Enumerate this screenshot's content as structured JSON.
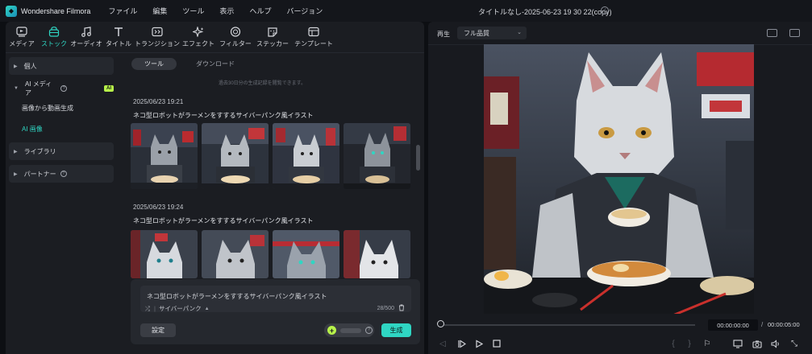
{
  "app": {
    "name": "Wondershare Filmora",
    "logo": "filmora-logo"
  },
  "menu": [
    "ファイル",
    "編集",
    "ツール",
    "表示",
    "ヘルプ",
    "バージョン"
  ],
  "document": {
    "title": "タイトルなし-2025-06-23 19 30 22(copy)"
  },
  "toolbar": [
    {
      "id": "media",
      "label": "メディア",
      "icon": "media-icon"
    },
    {
      "id": "stock",
      "label": "ストック",
      "icon": "stock-icon",
      "active": true
    },
    {
      "id": "audio",
      "label": "オーディオ",
      "icon": "music-note-icon"
    },
    {
      "id": "title",
      "label": "タイトル",
      "icon": "text-icon"
    },
    {
      "id": "transition",
      "label": "トランジション",
      "icon": "transition-icon"
    },
    {
      "id": "effect",
      "label": "エフェクト",
      "icon": "sparkle-icon"
    },
    {
      "id": "filter",
      "label": "フィルター",
      "icon": "filter-icon"
    },
    {
      "id": "sticker",
      "label": "ステッカー",
      "icon": "sticker-icon"
    },
    {
      "id": "template",
      "label": "テンプレート",
      "icon": "template-icon"
    }
  ],
  "sidebar": {
    "personal": "個人",
    "ai_media": {
      "label": "AI メディア",
      "badge": "AI"
    },
    "ai_items": [
      "画像から動画生成",
      "AI 画像"
    ],
    "library": "ライブラリ",
    "partner": "パートナー"
  },
  "tabs": [
    "ツール",
    "ダウンロード"
  ],
  "hint": "過去30日分の生成記録を閲覧できます。",
  "groups": [
    {
      "timestamp": "2025/06/23 19:21",
      "prompt": "ネコ型ロボットがラーメンをすするサイバーパンク風イラスト"
    },
    {
      "timestamp": "2025/06/23 19:24",
      "prompt": "ネコ型ロボットがラーメンをすするサイバーパンク風イラスト"
    }
  ],
  "prompt_box": {
    "text": "ネコ型ロボットがラーメンをすするサイバーパンク風イラスト",
    "style": "サイバーパンク",
    "count": "28/500",
    "settings": "設定",
    "generate": "生成"
  },
  "preview": {
    "label": "再生",
    "quality": "フル品質",
    "current_time": "00:00:00:00",
    "separator": "/",
    "total_time": "00:00:05:00"
  },
  "colors": {
    "accent": "#2fd6c3",
    "badge": "#b7f34a",
    "bg": "#0d0f13",
    "panel": "#1b1d22"
  }
}
